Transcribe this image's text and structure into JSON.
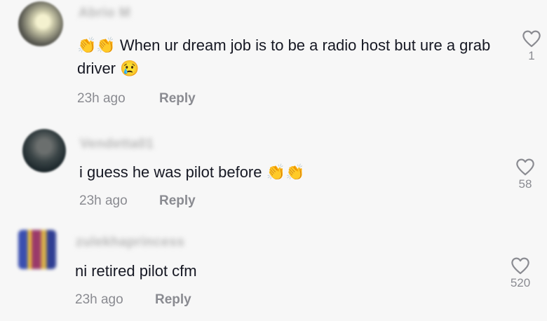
{
  "comments": [
    {
      "username": "Abrio M",
      "emoji_prefix": "👏👏",
      "text": " When ur dream job is to be a radio host but ure a grab driver 😢",
      "time": "23h ago",
      "reply_label": "Reply",
      "likes": "1"
    },
    {
      "username": "Vendetta01",
      "text": "i guess he was pilot before 👏👏",
      "time": "23h ago",
      "reply_label": "Reply",
      "likes": "58"
    },
    {
      "username": "zulekhaprincess",
      "text": "ni retired pilot cfm",
      "time": "23h ago",
      "reply_label": "Reply",
      "likes": "520"
    }
  ]
}
